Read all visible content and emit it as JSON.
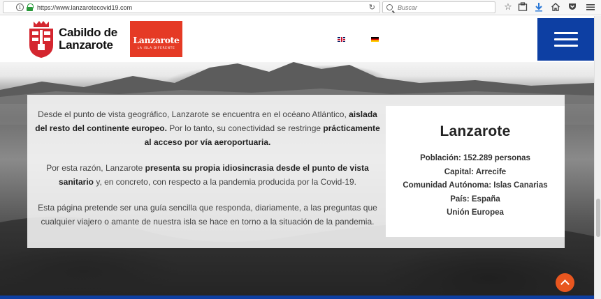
{
  "browser": {
    "url": "https://www.lanzarotecovid19.com",
    "search_placeholder": "Buscar"
  },
  "header": {
    "cabildo_line1": "Cabildo de",
    "cabildo_line2": "Lanzarote",
    "brand_name": "Lanzarote",
    "brand_tagline": "LA ISLA DIFERENTE",
    "accent_blue": "#0d3fa3",
    "brand_red": "#e53a25"
  },
  "main": {
    "p1_part1": "Desde el punto de vista geográfico, Lanzarote se encuentra en el océano Atlántico, ",
    "p1_bold1": "aislada del resto del continente europeo.",
    "p1_part2": " Por lo tanto, su conectividad se restringe ",
    "p1_bold2": "prácticamente al acceso por vía aeroportuaria.",
    "p2_part1": "Por esta razón, Lanzarote ",
    "p2_bold1": "presenta su propia idiosincrasia desde el punto de vista sanitario",
    "p2_part2": " y, en concreto, con respecto a la pandemia producida por la Covid-19.",
    "p3": "Esta página pretende ser una guía sencilla que responda, diariamente, a las preguntas que cualquier viajero o amante de nuestra isla se hace en torno a la situación de la pandemia."
  },
  "info": {
    "title": "Lanzarote",
    "poblacion": "Población: 152.289 personas",
    "capital": "Capital: Arrecife",
    "comunidad": "Comunidad Autónoma: Islas Canarias",
    "pais": "País: España",
    "union": "Unión Europea"
  },
  "scroll_top_color": "#e8561f"
}
